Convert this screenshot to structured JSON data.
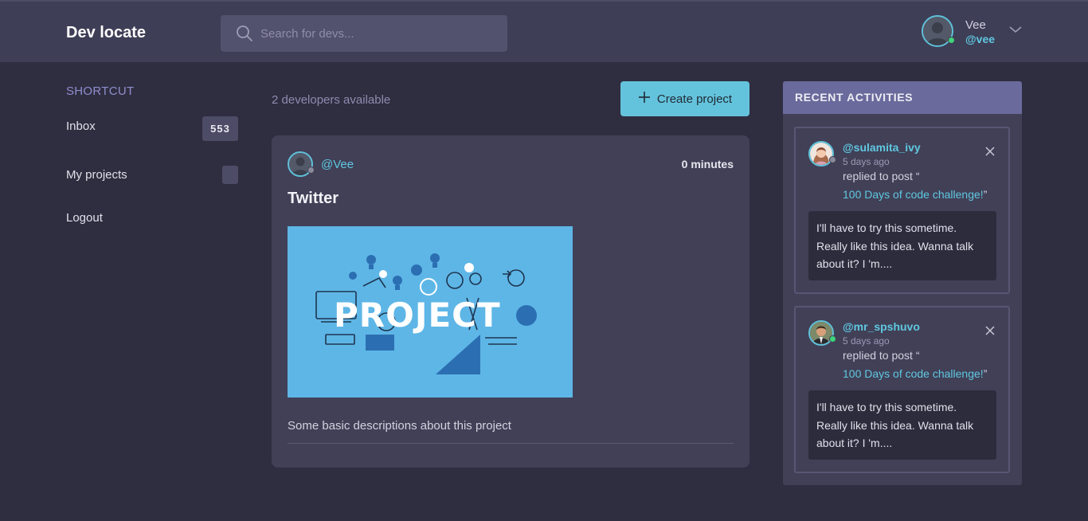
{
  "app": {
    "title": "Dev locate"
  },
  "search": {
    "placeholder": "Search for devs..."
  },
  "user": {
    "name": "Vee",
    "handle": "@vee",
    "status_color": "#3fd47a"
  },
  "sidebar": {
    "title": "SHORTCUT",
    "items": [
      {
        "label": "Inbox",
        "badge": "553"
      },
      {
        "label": "My projects",
        "badge": ""
      },
      {
        "label": "Logout"
      }
    ]
  },
  "main": {
    "dev_count": "2 developers available",
    "create_button": "Create project",
    "project": {
      "author": "@Vee",
      "time": "0 minutes",
      "title": "Twitter",
      "image_text": "PROJECT",
      "description": "Some basic descriptions about this project"
    }
  },
  "activities": {
    "title": "RECENT ACTIVITIES",
    "items": [
      {
        "handle": "@sulamita_ivy",
        "time": "5 days ago",
        "action": "replied to post “",
        "post": "100 Days of code challenge!",
        "quote_close": "”",
        "comment": "I'll have to try this sometime. Really like this idea. Wanna talk about it? I 'm...."
      },
      {
        "handle": "@mr_spshuvo",
        "time": "5 days ago",
        "action": "replied to post “",
        "post": "100 Days of code challenge!",
        "quote_close": "”",
        "comment": "I'll have to try this sometime. Really like this idea. Wanna talk about it? I 'm...."
      }
    ]
  },
  "colors": {
    "background": "#2f2e40",
    "topbar": "#3f3e57",
    "accent": "#64c3dc",
    "card": "#414057",
    "activities_header": "#6b6a9c",
    "online": "#3fd47a"
  },
  "icons": [
    "search-icon",
    "chevron-down-icon",
    "plus-icon",
    "close-icon",
    "default-avatar-icon"
  ]
}
